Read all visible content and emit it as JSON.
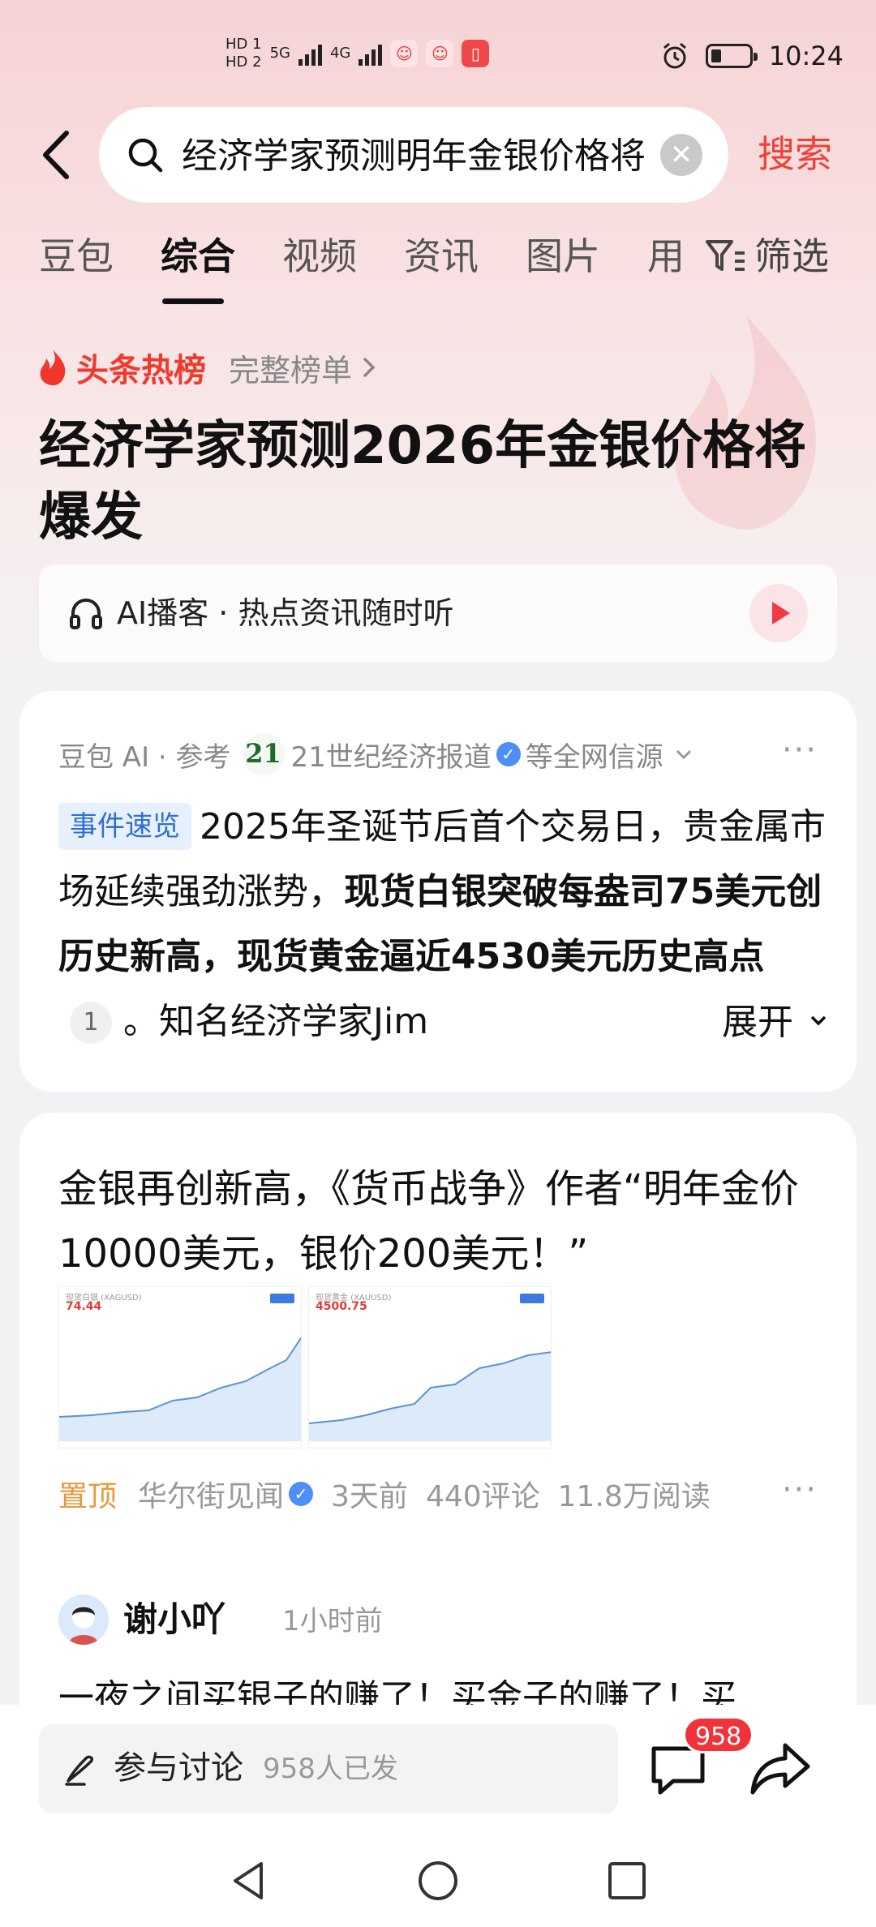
{
  "status_bar": {
    "hd1": "HD 1",
    "hd2": "HD 2",
    "net1": "5G",
    "net2": "4G",
    "time": "10:24"
  },
  "search": {
    "query": "经济学家预测明年金银价格将",
    "submit_label": "搜索"
  },
  "tabs": [
    {
      "label": "豆包",
      "active": false
    },
    {
      "label": "综合",
      "active": true
    },
    {
      "label": "视频",
      "active": false
    },
    {
      "label": "资讯",
      "active": false
    },
    {
      "label": "图片",
      "active": false
    },
    {
      "label": "用",
      "active": false
    }
  ],
  "filter_label": "筛选",
  "hot": {
    "label": "头条热榜",
    "full_list": "完整榜单",
    "headline": "经济学家预测2026年金银价格将爆发"
  },
  "podcast": {
    "text": "AI播客 · 热点资讯随时听"
  },
  "ai_card": {
    "source_prefix": "豆包 AI · 参考",
    "logo_text": "21",
    "source_name": "21世纪经济报道",
    "source_suffix": "等全网信源",
    "tag": "事件速览",
    "text_1": "2025年圣诞节后首个交易日，贵金属市场延续强劲涨势，",
    "bold_1": "现货白银突破每盎司75美元创历史新高，",
    "bold_2": "现货黄金逼近4530美元历史高点",
    "ref": "1",
    "text_2": "。知名经济学家Jim",
    "expand_label": "展开"
  },
  "news_card": {
    "title": "金银再创新高，《货币战争》作者“明年金价10000美元，银价200美元！”",
    "thumb1": {
      "head": "现货白银 (XAGUSD)",
      "price": "74.44"
    },
    "thumb2": {
      "head": "现货黄金 (XAUUSD)",
      "price": "4500.75"
    },
    "pin": "置顶",
    "source": "华尔街见闻",
    "time": "3天前",
    "comments": "440评论",
    "reads": "11.8万阅读"
  },
  "comment": {
    "name": "谢小吖",
    "time": "1小时前",
    "text": "一夜之间买银子的赚了！买金子的赚了！买"
  },
  "bottom": {
    "discuss_label": "参与讨论",
    "discuss_count": "958人已发",
    "badge_count": "958"
  },
  "colors": {
    "accent_red": "#ef4136",
    "tag_blue": "#2f6fd6",
    "pin_orange": "#e59a3b",
    "badge_red": "#f0333a"
  }
}
